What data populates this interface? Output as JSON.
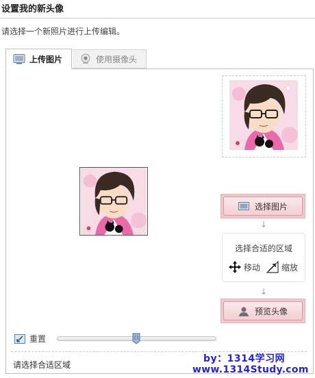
{
  "header": {
    "title": "设置我的新头像",
    "subtitle": "请选择一个新照片进行上传编辑。"
  },
  "tabs": [
    {
      "label": "上传图片",
      "icon": "picture-icon",
      "active": true
    },
    {
      "label": "使用摄像头",
      "icon": "webcam-icon",
      "active": false
    }
  ],
  "actions": {
    "select_image": "选择图片",
    "arrow": "↓",
    "area_title": "选择合适的区域",
    "move_label": "移动",
    "scale_label": "缩放",
    "preview_avatar": "预览头像"
  },
  "controls": {
    "reset_label": "重置",
    "zoom_level": 0.5
  },
  "status": "请选择合适区域",
  "watermark": {
    "line1": "by：1314学习网",
    "line2": "www.1314Study.com"
  },
  "colors": {
    "accent_pink": "#efc7cc",
    "watermark_blue": "#2424d6"
  }
}
